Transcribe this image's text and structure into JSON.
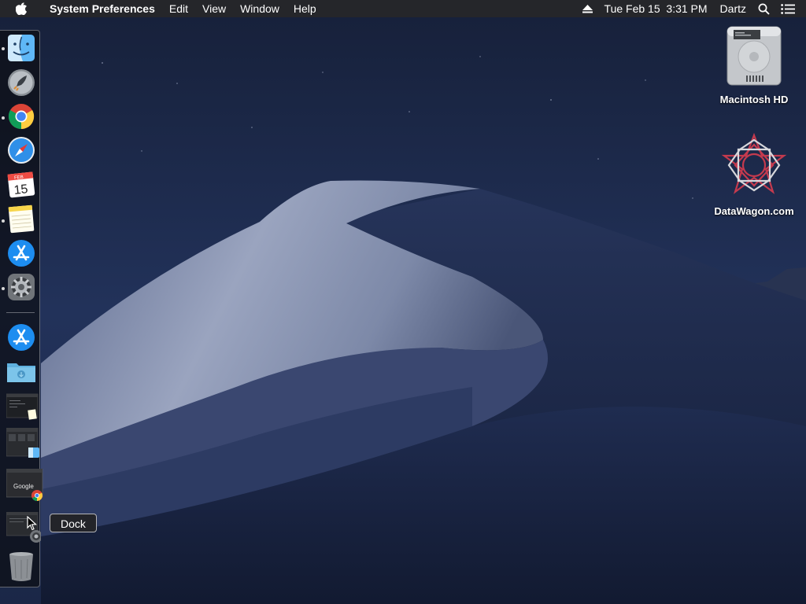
{
  "menubar": {
    "apple_icon": "apple-logo-icon",
    "app_name": "System Preferences",
    "menus": [
      "Edit",
      "View",
      "Window",
      "Help"
    ],
    "status": {
      "eject_icon": "eject-icon",
      "datetime": "Tue Feb 15  3:31 PM",
      "user": "Dartz",
      "spotlight_icon": "search-icon",
      "notification_icon": "list-icon"
    }
  },
  "dock": {
    "apps": [
      {
        "name": "Finder",
        "icon": "finder-icon",
        "running": true
      },
      {
        "name": "Launchpad",
        "icon": "launchpad-icon",
        "running": false
      },
      {
        "name": "Google Chrome",
        "icon": "chrome-icon",
        "running": true
      },
      {
        "name": "Safari",
        "icon": "safari-icon",
        "running": false
      },
      {
        "name": "Calendar",
        "icon": "calendar-icon",
        "running": false,
        "month": "FEB",
        "day": "15"
      },
      {
        "name": "Notes",
        "icon": "notes-icon",
        "running": true
      },
      {
        "name": "App Store",
        "icon": "app-store-icon",
        "running": false
      },
      {
        "name": "System Preferences",
        "icon": "gear-icon",
        "running": true
      }
    ],
    "others": [
      {
        "name": "App Store download",
        "icon": "app-store-icon"
      },
      {
        "name": "Downloads folder",
        "icon": "folder-icon"
      },
      {
        "name": "Minimized Notes window",
        "icon": "window-thumbnail-icon"
      },
      {
        "name": "Minimized Finder window",
        "icon": "window-thumbnail-icon"
      },
      {
        "name": "Minimized Chrome window",
        "icon": "window-thumbnail-icon",
        "thumb_text": "Google"
      },
      {
        "name": "Minimized System Preferences window",
        "icon": "window-thumbnail-icon"
      },
      {
        "name": "Trash",
        "icon": "trash-icon"
      }
    ]
  },
  "tooltip": "Dock",
  "desktop": {
    "icons": [
      {
        "label": "Macintosh HD",
        "icon": "hard-drive-icon"
      },
      {
        "label": "DataWagon.com",
        "icon": "star-pattern-icon"
      }
    ]
  },
  "colors": {
    "menubar_bg": "#25262a",
    "sky_top": "#16203a",
    "dune_light": "#8e9ab8",
    "dune_dark": "#1b2748"
  }
}
